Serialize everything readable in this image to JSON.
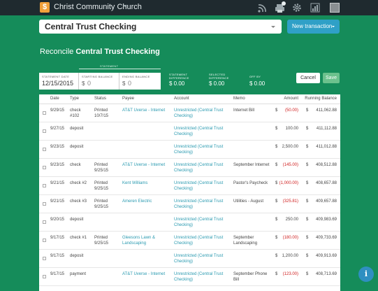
{
  "topbar": {
    "logo_char": "$",
    "org_name": "Christ Community Church",
    "icons": [
      "rss-icon",
      "printer-icon",
      "gear-icon",
      "chart-icon",
      "avatar-icon"
    ],
    "colors": {
      "bar": "#1f2a2f",
      "logo": "#f2a13a"
    }
  },
  "account_select": {
    "value": "Central Trust Checking"
  },
  "new_transaction_label": "New transaction",
  "page": {
    "title_prefix": "Reconcile",
    "title_account": "Central Trust Checking",
    "background": "#158c5a"
  },
  "statement": {
    "group_label": "STATEMENT",
    "date_label": "STATEMENT DATE",
    "date_value": "12/15/2015",
    "starting_label": "STARTING BALANCE",
    "starting_value": "0",
    "ending_label": "ENDING BALANCE",
    "ending_value": "0",
    "currency": "$"
  },
  "summary": {
    "statement_diff_label_1": "STATEMENT",
    "statement_diff_label_2": "DIFFERENCE",
    "statement_diff_value": "$ 0.00",
    "selected_diff_label_1": "SELECTED",
    "selected_diff_label_2": "DIFFERENCE",
    "selected_diff_value": "$ 0.00",
    "off_by_label": "OFF BY",
    "off_by_value": "$ 0.00"
  },
  "buttons": {
    "cancel": "Cancel",
    "save": "Save"
  },
  "table": {
    "columns": [
      "Date",
      "Type",
      "Status",
      "Payee",
      "Account",
      "Memo",
      "Amount",
      "Running Balance"
    ],
    "rows": [
      {
        "date": "9/29/15",
        "type_1": "check",
        "type_2": "#102",
        "status_1": "Printed",
        "status_2": "10/7/15",
        "payee_1": "AT&T Uverse - Internet",
        "payee_2": "",
        "account_1": "Unrestricted (Central Trust",
        "account_2": "Checking)",
        "memo_1": "Internet Bill",
        "memo_2": "",
        "amt_cur": "$",
        "amount": "(50.00)",
        "neg": true,
        "bal_cur": "$",
        "balance": "411,062.88"
      },
      {
        "date": "9/27/15",
        "type_1": "deposit",
        "type_2": "",
        "status_1": "",
        "status_2": "",
        "payee_1": "",
        "payee_2": "",
        "account_1": "Unrestricted (Central Trust",
        "account_2": "Checking)",
        "memo_1": "",
        "memo_2": "",
        "amt_cur": "$",
        "amount": "100.00",
        "neg": false,
        "bal_cur": "$",
        "balance": "411,112.88"
      },
      {
        "date": "9/23/15",
        "type_1": "deposit",
        "type_2": "",
        "status_1": "",
        "status_2": "",
        "payee_1": "",
        "payee_2": "",
        "account_1": "Unrestricted (Central Trust",
        "account_2": "Checking)",
        "memo_1": "",
        "memo_2": "",
        "amt_cur": "$",
        "amount": "2,500.00",
        "neg": false,
        "bal_cur": "$",
        "balance": "411,012.88"
      },
      {
        "date": "9/23/15",
        "type_1": "check",
        "type_2": "",
        "status_1": "Printed",
        "status_2": "9/25/15",
        "payee_1": "AT&T Uverse - Internet",
        "payee_2": "",
        "account_1": "Unrestricted (Central Trust",
        "account_2": "Checking)",
        "memo_1": "September Internet",
        "memo_2": "",
        "amt_cur": "$",
        "amount": "(145.00)",
        "neg": true,
        "bal_cur": "$",
        "balance": "408,512.88"
      },
      {
        "date": "9/21/15",
        "type_1": "check #2",
        "type_2": "",
        "status_1": "Printed",
        "status_2": "9/25/15",
        "payee_1": "Kent Williams",
        "payee_2": "",
        "account_1": "Unrestricted (Central Trust",
        "account_2": "Checking)",
        "memo_1": "Pastor's Paycheck",
        "memo_2": "",
        "amt_cur": "$",
        "amount": "(1,000.00)",
        "neg": true,
        "bal_cur": "$",
        "balance": "408,657.88"
      },
      {
        "date": "9/21/15",
        "type_1": "check #3",
        "type_2": "",
        "status_1": "Printed",
        "status_2": "9/25/15",
        "payee_1": "Ameren Electric",
        "payee_2": "",
        "account_1": "Unrestricted (Central Trust",
        "account_2": "Checking)",
        "memo_1": "Utilities - August",
        "memo_2": "",
        "amt_cur": "$",
        "amount": "(325.81)",
        "neg": true,
        "bal_cur": "$",
        "balance": "409,657.88"
      },
      {
        "date": "9/20/15",
        "type_1": "deposit",
        "type_2": "",
        "status_1": "",
        "status_2": "",
        "payee_1": "",
        "payee_2": "",
        "account_1": "Unrestricted (Central Trust",
        "account_2": "Checking)",
        "memo_1": "",
        "memo_2": "",
        "amt_cur": "$",
        "amount": "250.00",
        "neg": false,
        "bal_cur": "$",
        "balance": "409,983.69"
      },
      {
        "date": "9/17/15",
        "type_1": "check #1",
        "type_2": "",
        "status_1": "Printed",
        "status_2": "9/25/15",
        "payee_1": "Gleesons Lawn &",
        "payee_2": "Landscaping",
        "account_1": "Unrestricted (Central Trust",
        "account_2": "Checking)",
        "memo_1": "September",
        "memo_2": "Landscaping",
        "amt_cur": "$",
        "amount": "(180.00)",
        "neg": true,
        "bal_cur": "$",
        "balance": "409,733.69"
      },
      {
        "date": "9/17/15",
        "type_1": "deposit",
        "type_2": "",
        "status_1": "",
        "status_2": "",
        "payee_1": "",
        "payee_2": "",
        "account_1": "Unrestricted (Central Trust",
        "account_2": "Checking)",
        "memo_1": "",
        "memo_2": "",
        "amt_cur": "$",
        "amount": "1,200.00",
        "neg": false,
        "bal_cur": "$",
        "balance": "409,913.69"
      },
      {
        "date": "9/17/15",
        "type_1": "payment",
        "type_2": "",
        "status_1": "",
        "status_2": "",
        "payee_1": "AT&T Uverse - Internet",
        "payee_2": "",
        "account_1": "Unrestricted (Central Trust",
        "account_2": "Checking)",
        "memo_1": "September Phone",
        "memo_2": "Bill",
        "amt_cur": "$",
        "amount": "(123.00)",
        "neg": true,
        "bal_cur": "$",
        "balance": "408,713.69"
      }
    ]
  },
  "info_button": "i"
}
